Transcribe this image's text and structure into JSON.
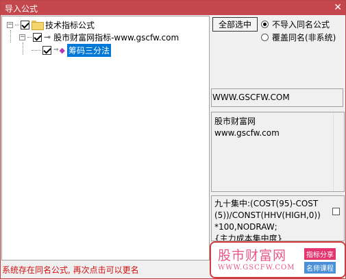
{
  "window": {
    "title": "导入公式",
    "close_glyph": "✕"
  },
  "tree": {
    "root": {
      "label": "技术指标公式",
      "expander": "−"
    },
    "child": {
      "label": "股市财富网指标-www.gscfw.com",
      "expander": "−"
    },
    "leaf": {
      "label": "筹码三分法"
    }
  },
  "options": {
    "select_all": "全部选中",
    "radio_skip": "不导入同名公式",
    "radio_overwrite": "覆盖同名(非系统)"
  },
  "url_value": "WWW.GSCFW.COM",
  "description": {
    "line1": "股市财富网",
    "line2": "www.gscfw.com"
  },
  "formula": {
    "line1": "九十集中:(COST(95)-COST",
    "line2": "(5))/CONST(HHV(HIGH,0))",
    "line3": "*100,NODRAW;",
    "line4": "{主力成本集中度}"
  },
  "watermark": {
    "site_cn": "股市财富网",
    "site_url": "WWW.GSCFW.COM",
    "tag1": "指标分享",
    "tag2": "名师课程"
  },
  "status_message": "系统存在同名公式, 再次点击可以更名",
  "colors": {
    "titlebar": "#c4474d",
    "selection": "#0078d7",
    "status": "#d01010"
  }
}
